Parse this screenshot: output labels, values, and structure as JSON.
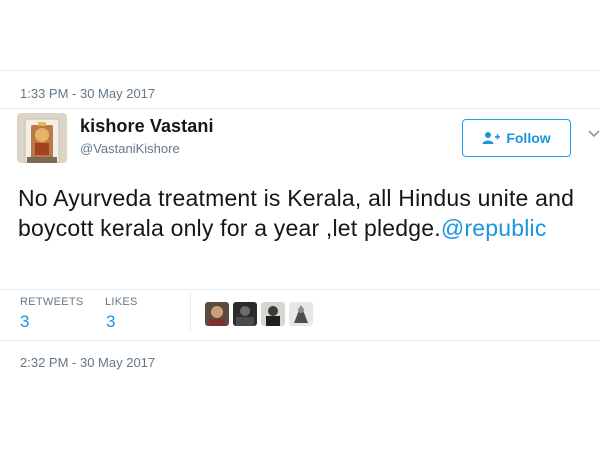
{
  "tweet": {
    "top_timestamp": "1:33 PM - 30 May 2017",
    "author": {
      "display_name": "kishore Vastani",
      "handle": "@VastaniKishore",
      "avatar_icon": "shrine-avatar-icon"
    },
    "follow_label": "Follow",
    "text_main": "No Ayurveda treatment is Kerala, all Hindus unite and boycott kerala only for a year ,let pledge.",
    "mention": "@republic",
    "stats": {
      "retweets_label": "RETWEETS",
      "retweets_count": "3",
      "likes_label": "LIKES",
      "likes_count": "3"
    },
    "liker_avatars": [
      "liker-avatar-icon",
      "liker-avatar-icon",
      "liker-avatar-icon",
      "liker-avatar-icon"
    ],
    "bottom_timestamp": "2:32 PM - 30 May 2017"
  },
  "colors": {
    "link": "#1b95e0",
    "border": "#1da1f2",
    "muted": "#657786",
    "text": "#14171a",
    "divider": "#e6ecf0"
  }
}
